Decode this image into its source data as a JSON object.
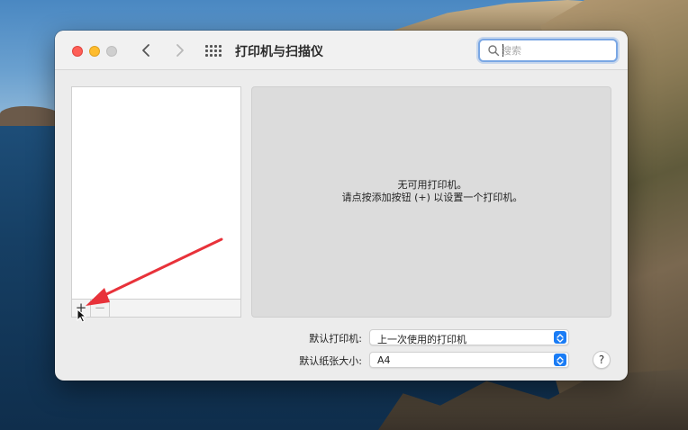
{
  "window": {
    "title": "打印机与扫描仪"
  },
  "toolbar": {
    "back_icon": "chevron-left",
    "forward_icon": "chevron-right",
    "show_all_icon": "grid"
  },
  "search": {
    "placeholder": "搜索",
    "value": ""
  },
  "printer_list": {
    "items": [],
    "add_label": "+",
    "remove_label": "−"
  },
  "detail": {
    "line1": "无可用打印机。",
    "line2": "请点按添加按钮 (+) 以设置一个打印机。"
  },
  "settings": {
    "default_printer_label": "默认打印机:",
    "default_printer_value": "上一次使用的打印机",
    "paper_size_label": "默认纸张大小:",
    "paper_size_value": "A4"
  },
  "help_label": "?",
  "colors": {
    "annotation_arrow": "#e8323a",
    "accent": "#1a7cf5",
    "search_focus": "#7aa7e4"
  }
}
